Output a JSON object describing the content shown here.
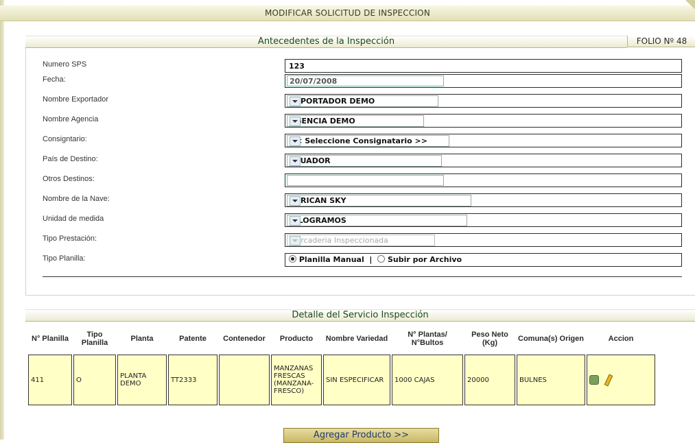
{
  "header": {
    "title": "MODIFICAR SOLICITUD DE INSPECCION"
  },
  "antecedentes": {
    "title": "Antecedentes de la Inspección",
    "folio": "FOLIO Nº 48"
  },
  "form": {
    "numero_sps": {
      "label": "Numero SPS",
      "value": "123"
    },
    "fecha": {
      "label": "Fecha:",
      "value": "20/07/2008"
    },
    "exportador": {
      "label": "Nombre Exportador",
      "value": "EXPORTADOR DEMO"
    },
    "agencia": {
      "label": "Nombre Agencia",
      "value": "AGENCIA DEMO"
    },
    "consignatario": {
      "label": "Consigntario:",
      "value": "<< Seleccione Consignatario >>"
    },
    "pais_destino": {
      "label": "País de Destino:",
      "value": "ECUADOR"
    },
    "otros_destinos": {
      "label": "Otros Destinos:",
      "value": ""
    },
    "nave": {
      "label": "Nombre de la Nave:",
      "value": "AFRICAN SKY"
    },
    "unidad": {
      "label": "Unidad de medida",
      "value": "KILOGRAMOS"
    },
    "prestacion": {
      "label": "Tipo Prestación:",
      "value": "Mercaderia Inspeccionada"
    },
    "planilla": {
      "label": "Tipo Planilla:",
      "option_manual": "Planilla Manual",
      "separator": "|",
      "option_archivo": "Subir por Archivo",
      "selected": "Planilla Manual"
    }
  },
  "detalle": {
    "title": "Detalle del Servicio Inspección",
    "columns": [
      "N° Planilla",
      "Tipo Planilla",
      "Planta",
      "Patente",
      "Contenedor",
      "Producto",
      "Nombre Variedad",
      "N° Plantas/ N°Bultos",
      "Peso Neto (Kg)",
      "Comuna(s) Origen",
      "Accion"
    ],
    "rows": [
      [
        "411",
        "O",
        "PLANTA DEMO",
        "TT2333",
        "",
        "MANZANAS FRESCAS (MANZANA-FRESCO)",
        "SIN ESPECIFICAR",
        "1000 CAJAS",
        "20000",
        "BULNES"
      ]
    ]
  },
  "actions": {
    "agregar": "Agregar Producto >>"
  },
  "icons": {
    "delete": "trash-icon",
    "edit": "pencil-icon"
  }
}
